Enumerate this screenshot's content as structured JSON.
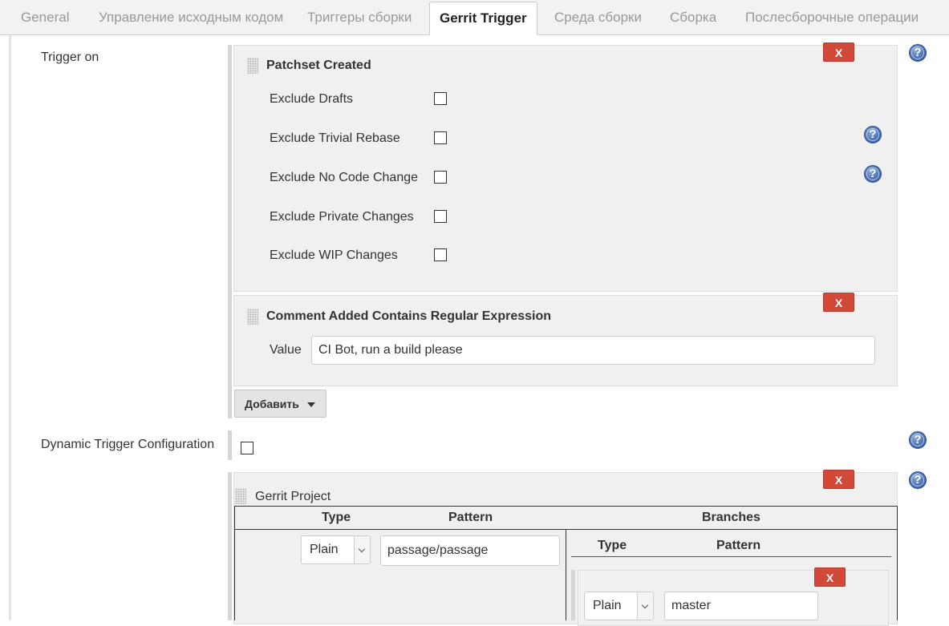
{
  "tabs": [
    {
      "label": "General"
    },
    {
      "label": "Управление исходным кодом"
    },
    {
      "label": "Триггеры сборки"
    },
    {
      "label": "Gerrit Trigger"
    },
    {
      "label": "Среда сборки"
    },
    {
      "label": "Сборка"
    },
    {
      "label": "Послесборочные операции"
    }
  ],
  "trigger_on": {
    "label": "Trigger on",
    "patchset_created": {
      "title": "Patchset Created",
      "remove_label": "X",
      "options": [
        {
          "label": "Exclude Drafts",
          "checked": false
        },
        {
          "label": "Exclude Trivial Rebase",
          "checked": false
        },
        {
          "label": "Exclude No Code Change",
          "checked": false
        },
        {
          "label": "Exclude Private Changes",
          "checked": false
        },
        {
          "label": "Exclude WIP Changes",
          "checked": false
        }
      ]
    },
    "comment_added": {
      "title": "Comment Added Contains Regular Expression",
      "remove_label": "X",
      "value_label": "Value",
      "value": "CI Bot, run a build please"
    },
    "add_button": "Добавить"
  },
  "dynamic_trigger": {
    "label": "Dynamic Trigger Configuration",
    "checked": false
  },
  "gerrit_project": {
    "title": "Gerrit Project",
    "remove_label": "X",
    "headers": {
      "type": "Type",
      "pattern": "Pattern",
      "branches": "Branches"
    },
    "type_value": "Plain",
    "pattern_value": "passage/passage",
    "branches": {
      "headers": {
        "type": "Type",
        "pattern": "Pattern"
      },
      "remove_label": "X",
      "type_value": "Plain",
      "pattern_value": "master"
    }
  },
  "help_icon_glyph": "?",
  "colors": {
    "remove_button": "#d24939",
    "help_icon": "#4a72b5"
  }
}
